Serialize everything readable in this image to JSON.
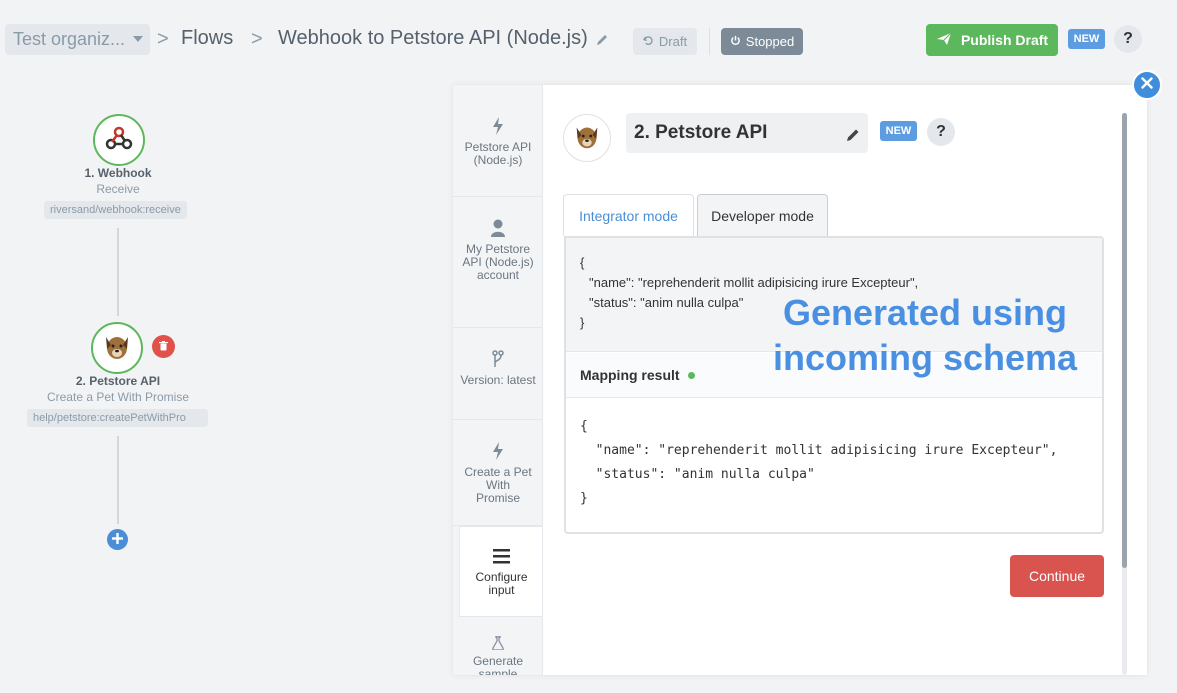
{
  "header": {
    "org": "Test organiz...",
    "breadcrumb_sep": ">",
    "flows": "Flows",
    "flow_name": "Webhook to Petstore API (Node.js)",
    "draft": "Draft",
    "stopped": "Stopped",
    "publish": "Publish Draft",
    "new_badge": "NEW",
    "help": "?"
  },
  "flow": {
    "node1": {
      "title": "1. Webhook",
      "sub": "Receive",
      "tag": "riversand/webhook:receive"
    },
    "node2": {
      "title": "2. Petstore API",
      "sub": "Create a Pet With Promise",
      "tag": "help/petstore:createPetWithPro"
    }
  },
  "sidenav": [
    {
      "label": "Petstore API (Node.js)",
      "icon": "bolt-icon"
    },
    {
      "label": "My Petstore API (Node.js) account",
      "icon": "user-icon"
    },
    {
      "label": "Version: latest",
      "icon": "branch-icon"
    },
    {
      "label": "Create a Pet With Promise",
      "icon": "bolt-icon"
    },
    {
      "label": "Configure input",
      "icon": "menu-icon"
    },
    {
      "label": "Generate sample",
      "icon": "flask-icon"
    }
  ],
  "step": {
    "name": "2. Petstore API",
    "new_badge": "NEW",
    "help": "?"
  },
  "tabs": {
    "integrator": "Integrator mode",
    "developer": "Developer mode"
  },
  "editor": {
    "open": "{",
    "line1": "\"name\": \"reprehenderit mollit adipisicing irure Excepteur\",",
    "line2": "\"status\": \"anim nulla culpa\"",
    "close": "}"
  },
  "mapping": {
    "title": "Mapping result",
    "result": "{\n  \"name\": \"reprehenderit mollit adipisicing irure Excepteur\",\n  \"status\": \"anim nulla culpa\"\n}"
  },
  "overlay": {
    "line1": "Generated using",
    "line2": "incoming schema"
  },
  "continue": "Continue",
  "colors": {
    "accent": "#4a8ed6",
    "publish": "#5cb85c",
    "danger": "#d9534f",
    "stopped": "#7d8b99"
  }
}
